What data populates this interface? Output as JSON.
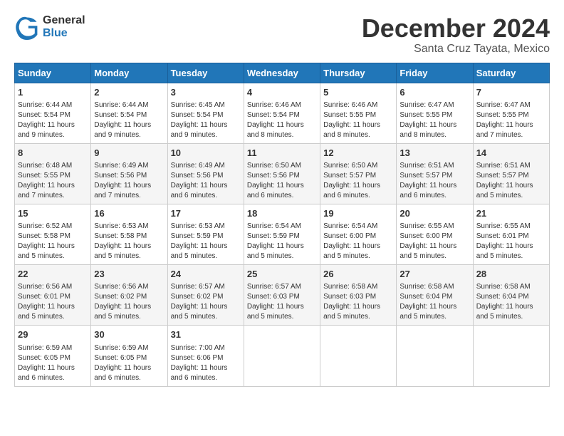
{
  "logo": {
    "line1": "General",
    "line2": "Blue"
  },
  "title": "December 2024",
  "subtitle": "Santa Cruz Tayata, Mexico",
  "days_of_week": [
    "Sunday",
    "Monday",
    "Tuesday",
    "Wednesday",
    "Thursday",
    "Friday",
    "Saturday"
  ],
  "weeks": [
    [
      {
        "day": "1",
        "info": "Sunrise: 6:44 AM\nSunset: 5:54 PM\nDaylight: 11 hours\nand 9 minutes."
      },
      {
        "day": "2",
        "info": "Sunrise: 6:44 AM\nSunset: 5:54 PM\nDaylight: 11 hours\nand 9 minutes."
      },
      {
        "day": "3",
        "info": "Sunrise: 6:45 AM\nSunset: 5:54 PM\nDaylight: 11 hours\nand 9 minutes."
      },
      {
        "day": "4",
        "info": "Sunrise: 6:46 AM\nSunset: 5:54 PM\nDaylight: 11 hours\nand 8 minutes."
      },
      {
        "day": "5",
        "info": "Sunrise: 6:46 AM\nSunset: 5:55 PM\nDaylight: 11 hours\nand 8 minutes."
      },
      {
        "day": "6",
        "info": "Sunrise: 6:47 AM\nSunset: 5:55 PM\nDaylight: 11 hours\nand 8 minutes."
      },
      {
        "day": "7",
        "info": "Sunrise: 6:47 AM\nSunset: 5:55 PM\nDaylight: 11 hours\nand 7 minutes."
      }
    ],
    [
      {
        "day": "8",
        "info": "Sunrise: 6:48 AM\nSunset: 5:55 PM\nDaylight: 11 hours\nand 7 minutes."
      },
      {
        "day": "9",
        "info": "Sunrise: 6:49 AM\nSunset: 5:56 PM\nDaylight: 11 hours\nand 7 minutes."
      },
      {
        "day": "10",
        "info": "Sunrise: 6:49 AM\nSunset: 5:56 PM\nDaylight: 11 hours\nand 6 minutes."
      },
      {
        "day": "11",
        "info": "Sunrise: 6:50 AM\nSunset: 5:56 PM\nDaylight: 11 hours\nand 6 minutes."
      },
      {
        "day": "12",
        "info": "Sunrise: 6:50 AM\nSunset: 5:57 PM\nDaylight: 11 hours\nand 6 minutes."
      },
      {
        "day": "13",
        "info": "Sunrise: 6:51 AM\nSunset: 5:57 PM\nDaylight: 11 hours\nand 6 minutes."
      },
      {
        "day": "14",
        "info": "Sunrise: 6:51 AM\nSunset: 5:57 PM\nDaylight: 11 hours\nand 5 minutes."
      }
    ],
    [
      {
        "day": "15",
        "info": "Sunrise: 6:52 AM\nSunset: 5:58 PM\nDaylight: 11 hours\nand 5 minutes."
      },
      {
        "day": "16",
        "info": "Sunrise: 6:53 AM\nSunset: 5:58 PM\nDaylight: 11 hours\nand 5 minutes."
      },
      {
        "day": "17",
        "info": "Sunrise: 6:53 AM\nSunset: 5:59 PM\nDaylight: 11 hours\nand 5 minutes."
      },
      {
        "day": "18",
        "info": "Sunrise: 6:54 AM\nSunset: 5:59 PM\nDaylight: 11 hours\nand 5 minutes."
      },
      {
        "day": "19",
        "info": "Sunrise: 6:54 AM\nSunset: 6:00 PM\nDaylight: 11 hours\nand 5 minutes."
      },
      {
        "day": "20",
        "info": "Sunrise: 6:55 AM\nSunset: 6:00 PM\nDaylight: 11 hours\nand 5 minutes."
      },
      {
        "day": "21",
        "info": "Sunrise: 6:55 AM\nSunset: 6:01 PM\nDaylight: 11 hours\nand 5 minutes."
      }
    ],
    [
      {
        "day": "22",
        "info": "Sunrise: 6:56 AM\nSunset: 6:01 PM\nDaylight: 11 hours\nand 5 minutes."
      },
      {
        "day": "23",
        "info": "Sunrise: 6:56 AM\nSunset: 6:02 PM\nDaylight: 11 hours\nand 5 minutes."
      },
      {
        "day": "24",
        "info": "Sunrise: 6:57 AM\nSunset: 6:02 PM\nDaylight: 11 hours\nand 5 minutes."
      },
      {
        "day": "25",
        "info": "Sunrise: 6:57 AM\nSunset: 6:03 PM\nDaylight: 11 hours\nand 5 minutes."
      },
      {
        "day": "26",
        "info": "Sunrise: 6:58 AM\nSunset: 6:03 PM\nDaylight: 11 hours\nand 5 minutes."
      },
      {
        "day": "27",
        "info": "Sunrise: 6:58 AM\nSunset: 6:04 PM\nDaylight: 11 hours\nand 5 minutes."
      },
      {
        "day": "28",
        "info": "Sunrise: 6:58 AM\nSunset: 6:04 PM\nDaylight: 11 hours\nand 5 minutes."
      }
    ],
    [
      {
        "day": "29",
        "info": "Sunrise: 6:59 AM\nSunset: 6:05 PM\nDaylight: 11 hours\nand 6 minutes."
      },
      {
        "day": "30",
        "info": "Sunrise: 6:59 AM\nSunset: 6:05 PM\nDaylight: 11 hours\nand 6 minutes."
      },
      {
        "day": "31",
        "info": "Sunrise: 7:00 AM\nSunset: 6:06 PM\nDaylight: 11 hours\nand 6 minutes."
      },
      {
        "day": "",
        "info": ""
      },
      {
        "day": "",
        "info": ""
      },
      {
        "day": "",
        "info": ""
      },
      {
        "day": "",
        "info": ""
      }
    ]
  ]
}
